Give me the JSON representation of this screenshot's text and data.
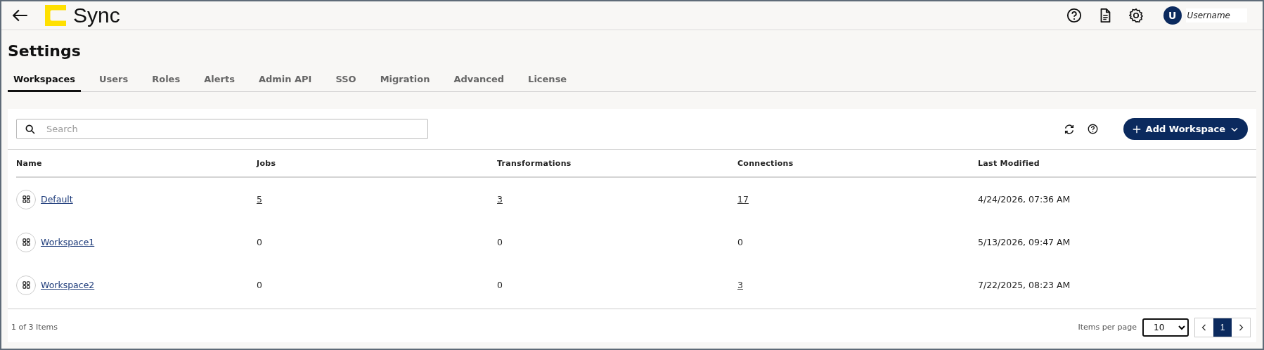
{
  "header": {
    "logo_text": "Sync",
    "user": {
      "initial": "U",
      "name": "Username"
    }
  },
  "page_title": "Settings",
  "tabs": [
    {
      "label": "Workspaces",
      "selected": true
    },
    {
      "label": "Users",
      "selected": false
    },
    {
      "label": "Roles",
      "selected": false
    },
    {
      "label": "Alerts",
      "selected": false
    },
    {
      "label": "Admin API",
      "selected": false
    },
    {
      "label": "SSO",
      "selected": false
    },
    {
      "label": "Migration",
      "selected": false
    },
    {
      "label": "Advanced",
      "selected": false
    },
    {
      "label": "License",
      "selected": false
    }
  ],
  "search": {
    "placeholder": "Search"
  },
  "add_button": {
    "label": "Add Workspace"
  },
  "table": {
    "columns": [
      "Name",
      "Jobs",
      "Transformations",
      "Connections",
      "Last Modified"
    ],
    "rows": [
      {
        "name": "Default",
        "jobs": {
          "text": "5",
          "link": true
        },
        "transformations": {
          "text": "3",
          "link": true
        },
        "connections": {
          "text": "17",
          "link": true
        },
        "last_modified": "4/24/2026, 07:36 AM"
      },
      {
        "name": "Workspace1",
        "jobs": {
          "text": "0",
          "link": false
        },
        "transformations": {
          "text": "0",
          "link": false
        },
        "connections": {
          "text": "0",
          "link": false
        },
        "last_modified": "5/13/2026, 09:47 AM"
      },
      {
        "name": "Workspace2",
        "jobs": {
          "text": "0",
          "link": false
        },
        "transformations": {
          "text": "0",
          "link": false
        },
        "connections": {
          "text": "3",
          "link": true
        },
        "last_modified": "7/22/2025, 08:23 AM"
      }
    ]
  },
  "footer": {
    "count": "1 of 3 Items",
    "items_per_page_label": "Items per page",
    "page_size": "10",
    "pages": [
      {
        "label": "1",
        "selected": true
      }
    ]
  }
}
